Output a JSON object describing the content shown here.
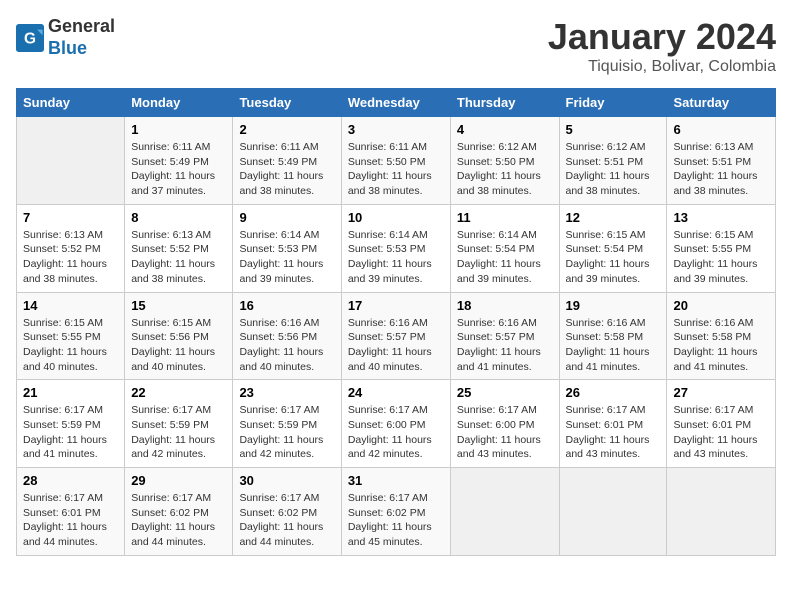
{
  "header": {
    "logo_general": "General",
    "logo_blue": "Blue",
    "month_title": "January 2024",
    "location": "Tiquisio, Bolivar, Colombia"
  },
  "weekdays": [
    "Sunday",
    "Monday",
    "Tuesday",
    "Wednesday",
    "Thursday",
    "Friday",
    "Saturday"
  ],
  "weeks": [
    [
      {
        "day": "",
        "info": ""
      },
      {
        "day": "1",
        "info": "Sunrise: 6:11 AM\nSunset: 5:49 PM\nDaylight: 11 hours\nand 37 minutes."
      },
      {
        "day": "2",
        "info": "Sunrise: 6:11 AM\nSunset: 5:49 PM\nDaylight: 11 hours\nand 38 minutes."
      },
      {
        "day": "3",
        "info": "Sunrise: 6:11 AM\nSunset: 5:50 PM\nDaylight: 11 hours\nand 38 minutes."
      },
      {
        "day": "4",
        "info": "Sunrise: 6:12 AM\nSunset: 5:50 PM\nDaylight: 11 hours\nand 38 minutes."
      },
      {
        "day": "5",
        "info": "Sunrise: 6:12 AM\nSunset: 5:51 PM\nDaylight: 11 hours\nand 38 minutes."
      },
      {
        "day": "6",
        "info": "Sunrise: 6:13 AM\nSunset: 5:51 PM\nDaylight: 11 hours\nand 38 minutes."
      }
    ],
    [
      {
        "day": "7",
        "info": "Sunrise: 6:13 AM\nSunset: 5:52 PM\nDaylight: 11 hours\nand 38 minutes."
      },
      {
        "day": "8",
        "info": "Sunrise: 6:13 AM\nSunset: 5:52 PM\nDaylight: 11 hours\nand 38 minutes."
      },
      {
        "day": "9",
        "info": "Sunrise: 6:14 AM\nSunset: 5:53 PM\nDaylight: 11 hours\nand 39 minutes."
      },
      {
        "day": "10",
        "info": "Sunrise: 6:14 AM\nSunset: 5:53 PM\nDaylight: 11 hours\nand 39 minutes."
      },
      {
        "day": "11",
        "info": "Sunrise: 6:14 AM\nSunset: 5:54 PM\nDaylight: 11 hours\nand 39 minutes."
      },
      {
        "day": "12",
        "info": "Sunrise: 6:15 AM\nSunset: 5:54 PM\nDaylight: 11 hours\nand 39 minutes."
      },
      {
        "day": "13",
        "info": "Sunrise: 6:15 AM\nSunset: 5:55 PM\nDaylight: 11 hours\nand 39 minutes."
      }
    ],
    [
      {
        "day": "14",
        "info": "Sunrise: 6:15 AM\nSunset: 5:55 PM\nDaylight: 11 hours\nand 40 minutes."
      },
      {
        "day": "15",
        "info": "Sunrise: 6:15 AM\nSunset: 5:56 PM\nDaylight: 11 hours\nand 40 minutes."
      },
      {
        "day": "16",
        "info": "Sunrise: 6:16 AM\nSunset: 5:56 PM\nDaylight: 11 hours\nand 40 minutes."
      },
      {
        "day": "17",
        "info": "Sunrise: 6:16 AM\nSunset: 5:57 PM\nDaylight: 11 hours\nand 40 minutes."
      },
      {
        "day": "18",
        "info": "Sunrise: 6:16 AM\nSunset: 5:57 PM\nDaylight: 11 hours\nand 41 minutes."
      },
      {
        "day": "19",
        "info": "Sunrise: 6:16 AM\nSunset: 5:58 PM\nDaylight: 11 hours\nand 41 minutes."
      },
      {
        "day": "20",
        "info": "Sunrise: 6:16 AM\nSunset: 5:58 PM\nDaylight: 11 hours\nand 41 minutes."
      }
    ],
    [
      {
        "day": "21",
        "info": "Sunrise: 6:17 AM\nSunset: 5:59 PM\nDaylight: 11 hours\nand 41 minutes."
      },
      {
        "day": "22",
        "info": "Sunrise: 6:17 AM\nSunset: 5:59 PM\nDaylight: 11 hours\nand 42 minutes."
      },
      {
        "day": "23",
        "info": "Sunrise: 6:17 AM\nSunset: 5:59 PM\nDaylight: 11 hours\nand 42 minutes."
      },
      {
        "day": "24",
        "info": "Sunrise: 6:17 AM\nSunset: 6:00 PM\nDaylight: 11 hours\nand 42 minutes."
      },
      {
        "day": "25",
        "info": "Sunrise: 6:17 AM\nSunset: 6:00 PM\nDaylight: 11 hours\nand 43 minutes."
      },
      {
        "day": "26",
        "info": "Sunrise: 6:17 AM\nSunset: 6:01 PM\nDaylight: 11 hours\nand 43 minutes."
      },
      {
        "day": "27",
        "info": "Sunrise: 6:17 AM\nSunset: 6:01 PM\nDaylight: 11 hours\nand 43 minutes."
      }
    ],
    [
      {
        "day": "28",
        "info": "Sunrise: 6:17 AM\nSunset: 6:01 PM\nDaylight: 11 hours\nand 44 minutes."
      },
      {
        "day": "29",
        "info": "Sunrise: 6:17 AM\nSunset: 6:02 PM\nDaylight: 11 hours\nand 44 minutes."
      },
      {
        "day": "30",
        "info": "Sunrise: 6:17 AM\nSunset: 6:02 PM\nDaylight: 11 hours\nand 44 minutes."
      },
      {
        "day": "31",
        "info": "Sunrise: 6:17 AM\nSunset: 6:02 PM\nDaylight: 11 hours\nand 45 minutes."
      },
      {
        "day": "",
        "info": ""
      },
      {
        "day": "",
        "info": ""
      },
      {
        "day": "",
        "info": ""
      }
    ]
  ]
}
